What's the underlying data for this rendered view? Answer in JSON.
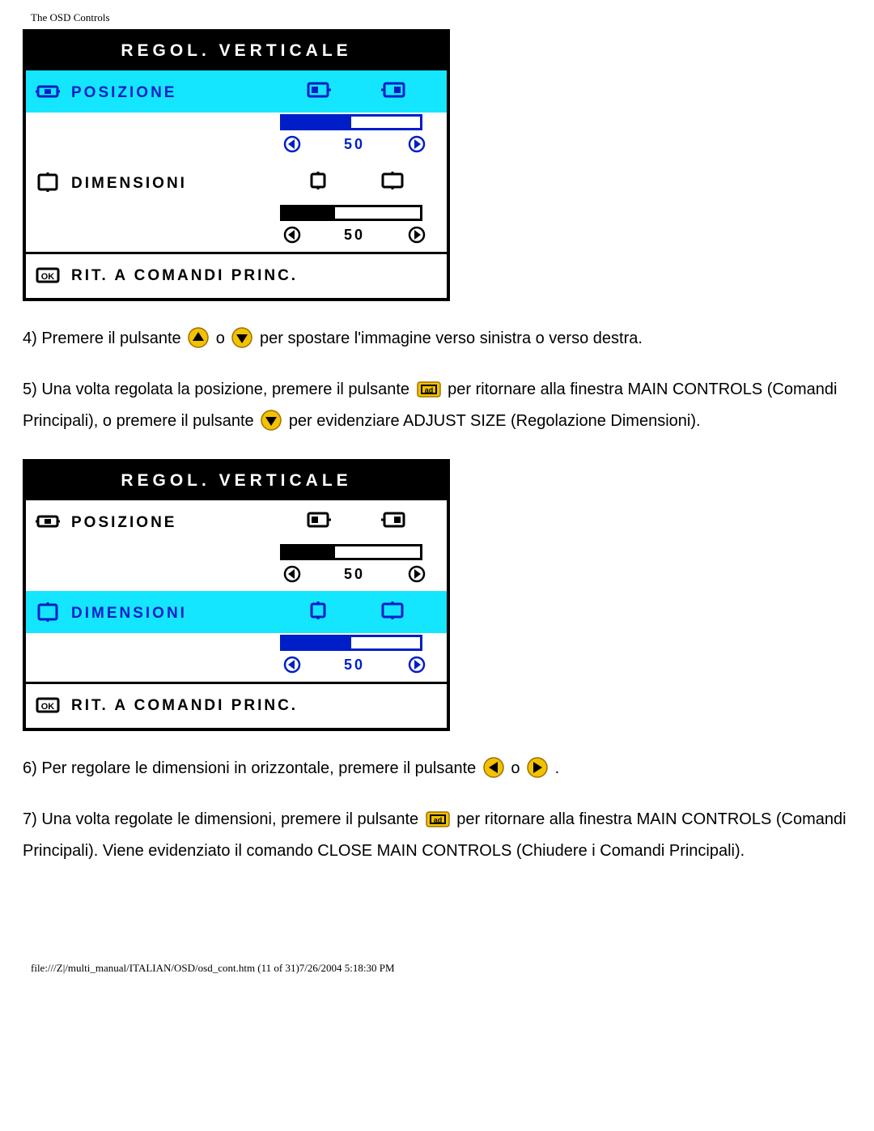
{
  "header": "The OSD Controls",
  "osd1": {
    "title": "REGOL. VERTICALE",
    "row_pos": {
      "label": "POSIZIONE",
      "value": "50",
      "highlight": true,
      "fill": 50
    },
    "row_dim": {
      "label": "DIMENSIONI",
      "value": "50",
      "highlight": false,
      "fill": 38
    },
    "footer": "RIT. A COMANDI PRINC."
  },
  "osd2": {
    "title": "REGOL. VERTICALE",
    "row_pos": {
      "label": "POSIZIONE",
      "value": "50",
      "highlight": false,
      "fill": 38
    },
    "row_dim": {
      "label": "DIMENSIONI",
      "value": "50",
      "highlight": true,
      "fill": 50
    },
    "footer": "RIT. A COMANDI PRINC."
  },
  "text": {
    "p4a": "4) Premere il pulsante ",
    "p4b": " o ",
    "p4c": " per spostare l'immagine verso sinistra o verso destra.",
    "p5a": "5) Una volta regolata la posizione, premere il pulsante ",
    "p5b": " per ritornare alla finestra MAIN CONTROLS (Comandi Principali), o premere il pulsante ",
    "p5c": " per evidenziare ADJUST SIZE (Regolazione Dimensioni).",
    "p6a": "6) Per regolare le dimensioni in orizzontale, premere il pulsante ",
    "p6b": "  o  ",
    "p6c": " .",
    "p7a": "7) Una volta regolate le dimensioni, premere il pulsante ",
    "p7b": " per ritornare alla finestra MAIN CONTROLS (Comandi Principali). Viene evidenziato il comando CLOSE MAIN CONTROLS (Chiudere i Comandi Principali)."
  },
  "footerline": "file:///Z|/multi_manual/ITALIAN/OSD/osd_cont.htm (11 of 31)7/26/2004 5:18:30 PM"
}
